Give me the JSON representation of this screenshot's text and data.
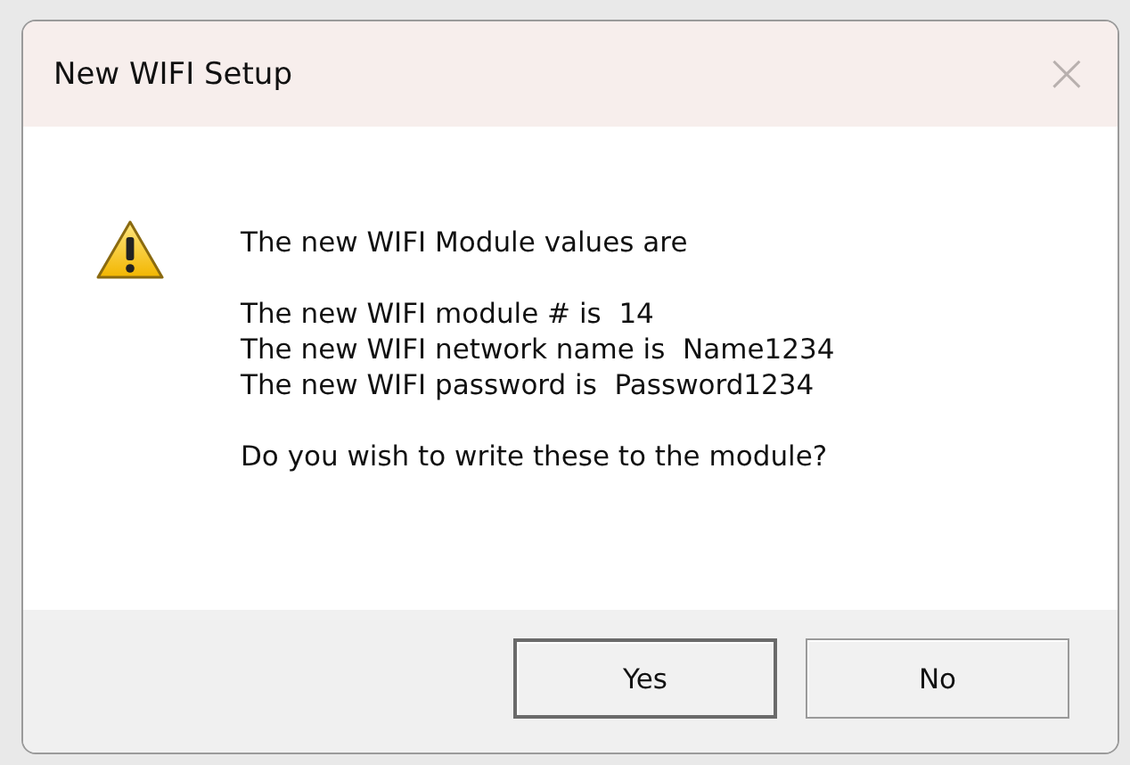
{
  "window": {
    "title": "New WIFI Setup",
    "close": "×"
  },
  "message": {
    "kind": "warning",
    "paragraphs": [
      [
        "The new WIFI Module values are"
      ],
      [
        "The new WIFI module # is  14",
        "The new WIFI network name is  Name1234",
        "The new WIFI password is  Password1234"
      ],
      [
        "Do you wish to write these to the module?"
      ]
    ]
  },
  "buttons": [
    {
      "label": "Yes",
      "default": true
    },
    {
      "label": "No",
      "default": false
    }
  ]
}
